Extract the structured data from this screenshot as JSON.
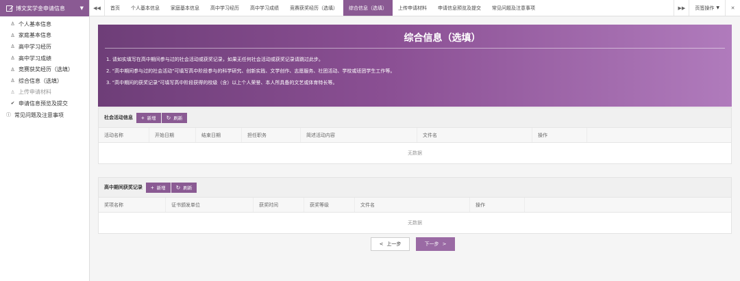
{
  "sidebar": {
    "header": "博文奖学金申请信息",
    "items": [
      {
        "label": "个人基本信息",
        "icon": "user-check-icon",
        "muted": false
      },
      {
        "label": "家庭基本信息",
        "icon": "user-check-icon",
        "muted": false
      },
      {
        "label": "高中学习经历",
        "icon": "user-check-icon",
        "muted": false
      },
      {
        "label": "高中学习成绩",
        "icon": "user-check-icon",
        "muted": false
      },
      {
        "label": "竞赛获奖经历（选填）",
        "icon": "user-check-icon",
        "muted": false
      },
      {
        "label": "综合信息（选填）",
        "icon": "user-check-icon",
        "muted": false
      },
      {
        "label": "上传申请材料",
        "icon": "user-icon",
        "muted": true
      },
      {
        "label": "申请信息预览及提交",
        "icon": "check-icon",
        "muted": false
      }
    ],
    "faq": "常见问题及注意事项"
  },
  "tabs": [
    {
      "label": "首页",
      "active": false
    },
    {
      "label": "个人基本信息",
      "active": false
    },
    {
      "label": "家庭基本信息",
      "active": false
    },
    {
      "label": "高中学习经历",
      "active": false
    },
    {
      "label": "高中学习成绩",
      "active": false
    },
    {
      "label": "竞赛获奖经历（选填）",
      "active": false
    },
    {
      "label": "综合信息（选填）",
      "active": true
    },
    {
      "label": "上传申请材料",
      "active": false
    },
    {
      "label": "申请信息预览及提交",
      "active": false
    },
    {
      "label": "常见问题及注意事项",
      "active": false
    }
  ],
  "page_ops": "页签操作",
  "banner": {
    "title": "综合信息（选填）",
    "notes": [
      "1. 请如实填写在高中期间参与过的社会活动或获奖记录，如果无任何社会活动或获奖记录请跳过此步。",
      "2. \"高中期间参与过的社会活动\"可填写高中阶段参与的科学研究、创新实践、文学创作、志愿服务、社团活动、学校或班团学生工作等。",
      "3. \"高中期间的获奖记录\"可填写高中阶段获得的校级（含）以上个人荣誉、本人所具备的文艺或体育特长等。"
    ]
  },
  "social": {
    "title": "社会活动信息",
    "add": "新增",
    "refresh": "刷新",
    "columns": [
      "活动名称",
      "开始日期",
      "结束日期",
      "担任职务",
      "简述活动内容",
      "文件名",
      "操作"
    ],
    "empty": "无数据"
  },
  "awards": {
    "title": "高中期间获奖记录",
    "add": "新增",
    "refresh": "刷新",
    "columns": [
      "奖项名称",
      "证书颁发单位",
      "获奖时间",
      "获奖等级",
      "文件名",
      "操作"
    ],
    "empty": "无数据"
  },
  "nav": {
    "prev": "上一步",
    "next": "下一步"
  },
  "colors": {
    "accent": "#8a5a93",
    "banner_start": "#6e3e78",
    "banner_end": "#b07bbc"
  }
}
